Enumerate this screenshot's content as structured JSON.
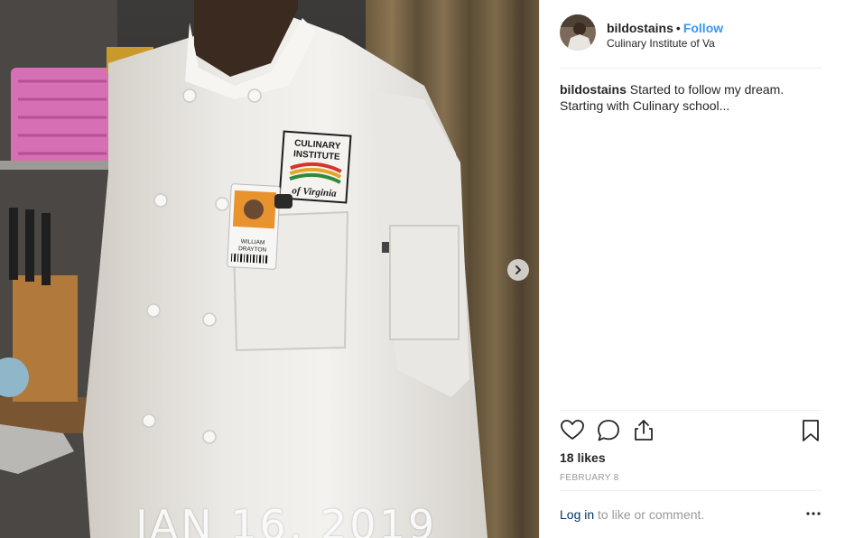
{
  "post": {
    "username": "bildostains",
    "separator": "•",
    "follow_label": "Follow",
    "location": "Culinary Institute of Va",
    "caption_user": "bildostains",
    "caption_text": "Started to follow my dream. Starting with Culinary school...",
    "likes": "18 likes",
    "date": "FEBRUARY 8"
  },
  "comment": {
    "login_label": "Log in",
    "prompt": "to like or comment."
  },
  "media": {
    "date_stamp": "JAN 16, 2019",
    "logo_line1": "CULINARY",
    "logo_line2": "INSTITUTE",
    "logo_line3": "of Virginia",
    "badge_line1": "WILLIAM",
    "badge_line2": "DRAYTON"
  },
  "icons": {
    "heart": "heart-icon",
    "comment": "comment-icon",
    "share": "share-icon",
    "save": "bookmark-icon",
    "more": "more-options-icon",
    "next": "chevron-right-icon"
  },
  "colors": {
    "follow": "#3897f0",
    "link": "#003569",
    "muted": "#999999",
    "divider": "#efefef"
  }
}
